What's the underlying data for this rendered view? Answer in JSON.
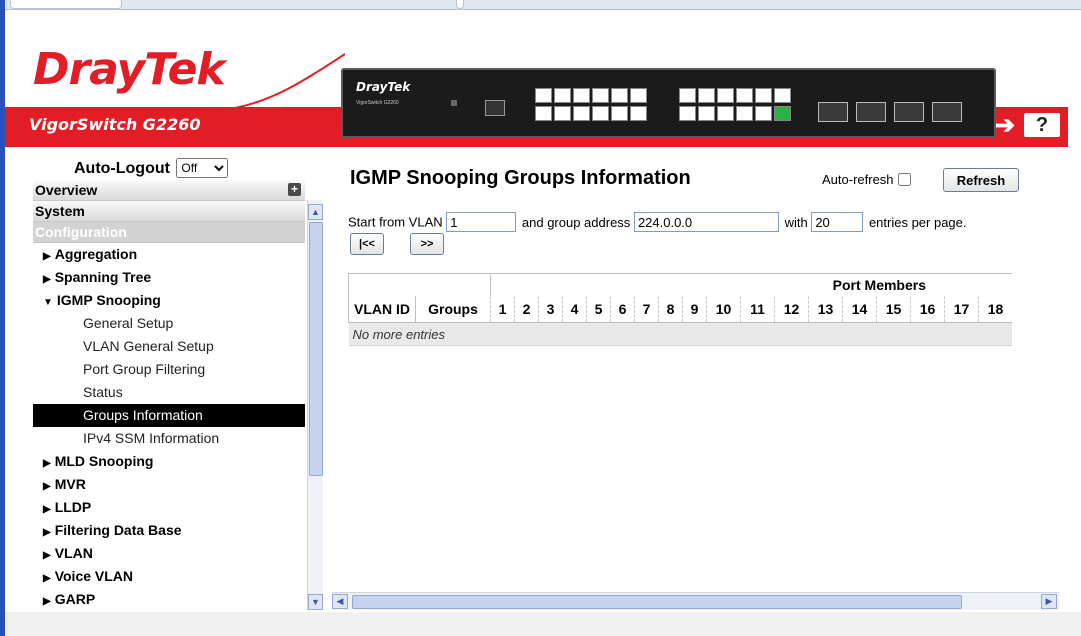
{
  "header": {
    "brand_dray": "Dray",
    "brand_tek": "Tek",
    "model": "VigorSwitch G2260",
    "device_brand": "DrayTek",
    "device_model": "VigorSwitch G2260",
    "colors": {
      "brand_red": "#e21d25",
      "device_body": "#1b1b1b",
      "link_green": "#2bb34a"
    },
    "icons": [
      "logout-arrow-icon",
      "help-icon"
    ],
    "help_label": "?"
  },
  "sidebar": {
    "auto_logout_label": "Auto-Logout",
    "auto_logout_value": "Off",
    "sections": {
      "overview": "Overview",
      "system": "System",
      "configuration": "Configuration"
    },
    "items": [
      {
        "label": "Aggregation",
        "expanded": false
      },
      {
        "label": "Spanning Tree",
        "expanded": false
      },
      {
        "label": "IGMP Snooping",
        "expanded": true
      },
      {
        "label": "MLD Snooping",
        "expanded": false
      },
      {
        "label": "MVR",
        "expanded": false
      },
      {
        "label": "LLDP",
        "expanded": false
      },
      {
        "label": "Filtering Data Base",
        "expanded": false
      },
      {
        "label": "VLAN",
        "expanded": false
      },
      {
        "label": "Voice VLAN",
        "expanded": false
      },
      {
        "label": "GARP",
        "expanded": false
      }
    ],
    "igmp_subitems": [
      "General Setup",
      "VLAN General Setup",
      "Port Group Filtering",
      "Status",
      "Groups Information",
      "IPv4 SSM Information"
    ],
    "active_subitem": "Groups Information"
  },
  "main": {
    "title": "IGMP Snooping Groups Information",
    "auto_refresh_label": "Auto-refresh",
    "auto_refresh_checked": false,
    "refresh_label": "Refresh",
    "start_from_vlan_label": "Start from VLAN",
    "start_vlan_value": "1",
    "group_address_label": "and group address",
    "group_address_value": "224.0.0.0",
    "with_label": "with",
    "entries_value": "20",
    "entries_suffix": "entries per page.",
    "first_page_label": "|<<",
    "next_page_label": ">>",
    "table": {
      "col_vlan_id": "VLAN ID",
      "col_groups": "Groups",
      "port_members_header": "Port Members",
      "ports": [
        "1",
        "2",
        "3",
        "4",
        "5",
        "6",
        "7",
        "8",
        "9",
        "10",
        "11",
        "12",
        "13",
        "14",
        "15",
        "16",
        "17",
        "18"
      ],
      "empty_text": "No more entries"
    }
  }
}
